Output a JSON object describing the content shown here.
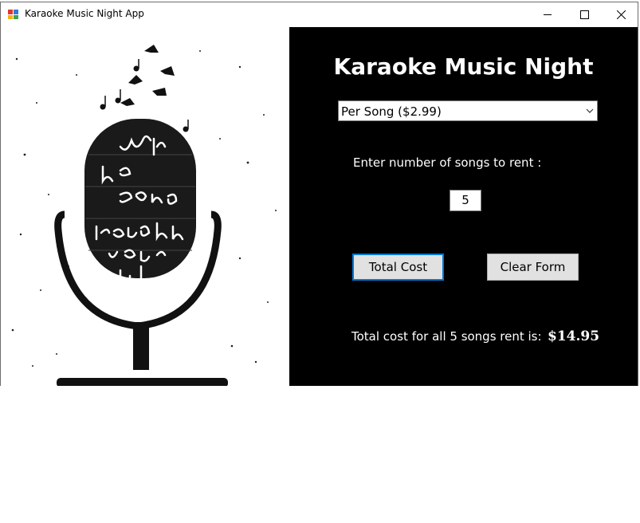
{
  "window": {
    "title": "Karaoke Music Night App",
    "controls": {
      "minimize": "minimize-icon",
      "maximize": "maximize-icon",
      "close": "close-icon"
    }
  },
  "art": {
    "icon": "microphone-illustration",
    "lettering": "with the song through your life"
  },
  "form": {
    "heading": "Karaoke Music Night",
    "rate_select": {
      "value": "Per Song ($2.99)"
    },
    "prompt_label": "Enter number of songs to rent :",
    "songs_value": "5",
    "total_button": "Total Cost",
    "clear_button": "Clear Form",
    "result_label": "Total cost for all 5 songs rent is:",
    "result_value": "$14.95"
  },
  "colors": {
    "panel_bg": "#000000",
    "focus_border": "#0078d7",
    "button_bg": "#e1e1e1"
  }
}
